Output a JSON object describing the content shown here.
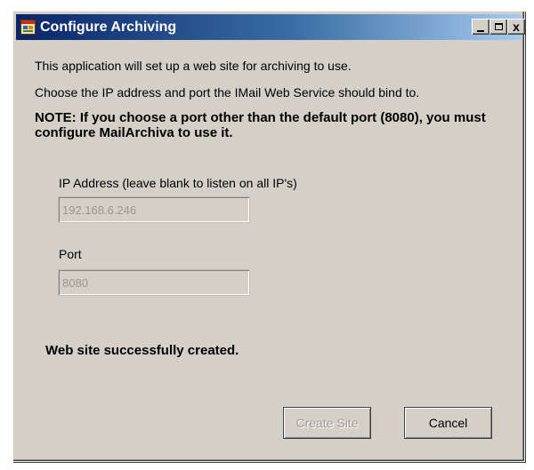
{
  "window": {
    "title": "Configure Archiving",
    "caption_buttons": {
      "minimize": "_",
      "maximize": "□",
      "close": "x"
    }
  },
  "content": {
    "intro_line1": "This application will set up a web site for archiving to use.",
    "intro_line2": "Choose the IP address and port the IMail Web Service should bind to.",
    "note": "NOTE: If you choose a port other than the default port (8080), you must configure MailArchiva to use it.",
    "ip_label": "IP Address (leave blank to listen on all IP's)",
    "ip_value": "192.168.6.246",
    "port_label": "Port",
    "port_value": "8080",
    "status": "Web site successfully created."
  },
  "buttons": {
    "create_site": "Create Site",
    "cancel": "Cancel"
  },
  "icons": {
    "app_icon": "application-window-icon",
    "minimize": "minimize-icon",
    "maximize": "maximize-icon",
    "close": "close-icon"
  },
  "colors": {
    "title_bar_start": "#0a246a",
    "title_bar_end": "#a6caf0",
    "window_face": "#d4d0c8",
    "disabled_text": "#a09c94"
  }
}
